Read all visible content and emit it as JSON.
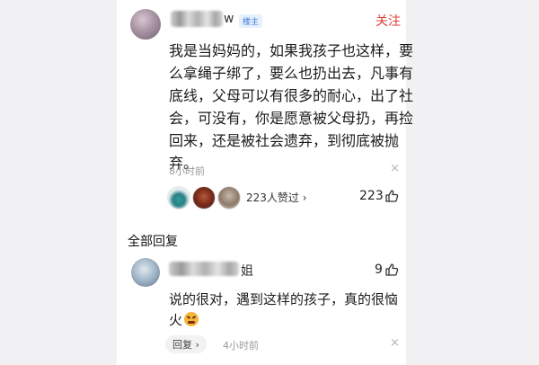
{
  "comment": {
    "author_suffix": "w",
    "host_badge": "楼主",
    "follow_label": "关注",
    "content_lines": [
      "我是当妈妈的，如果我孩子也这样，要",
      "么拿绳子绑了，要么也扔出去，凡事有",
      "底线，父母可以有很多的耐心，出了社",
      "会，可没有，你是愿意被父母扔，再捡",
      "回来，还是被社会遗弃，到彻底被抛",
      "弃。"
    ],
    "time": "8小时前",
    "close_icon": "×",
    "likers_text": "223人赞过 ›",
    "like_count": "223"
  },
  "replies_section": {
    "title": "全部回复"
  },
  "reply": {
    "author_suffix": "姐",
    "like_count": "9",
    "content_lines": [
      "说的很对，遇到这样的孩子，真的很恼",
      "火"
    ],
    "emoji_name": "angry-face",
    "reply_button": "回复 ›",
    "time": "4小时前",
    "close_icon": "×"
  },
  "colors": {
    "follow": "#e0403a",
    "host_badge": "#3b7fd9",
    "page_bg": "#ffffff",
    "side_bg": "#f1f1f3"
  }
}
